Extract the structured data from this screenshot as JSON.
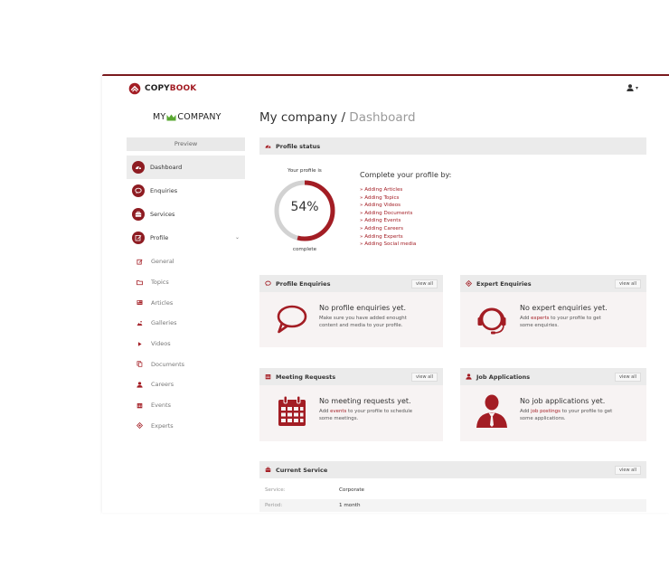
{
  "brand": {
    "name_dark": "COPY",
    "name_red": "BOOK",
    "accent": "#a31d24",
    "dark_accent": "#8e1c22"
  },
  "company": {
    "left": "MY",
    "right": "COMPANY"
  },
  "sidebar": {
    "preview_label": "Preview",
    "main_items": [
      {
        "label": "Dashboard",
        "icon": "dashboard-icon",
        "active": true
      },
      {
        "label": "Enquiries",
        "icon": "speech-bubble-icon"
      },
      {
        "label": "Services",
        "icon": "briefcase-icon"
      },
      {
        "label": "Profile",
        "icon": "edit-icon",
        "expandable": true
      }
    ],
    "sub_items": [
      {
        "label": "General",
        "icon": "edit-icon"
      },
      {
        "label": "Topics",
        "icon": "folder-icon"
      },
      {
        "label": "Articles",
        "icon": "newspaper-icon"
      },
      {
        "label": "Galleries",
        "icon": "image-icon"
      },
      {
        "label": "Videos",
        "icon": "play-icon"
      },
      {
        "label": "Documents",
        "icon": "documents-icon"
      },
      {
        "label": "Careers",
        "icon": "user-icon"
      },
      {
        "label": "Events",
        "icon": "calendar-icon"
      },
      {
        "label": "Experts",
        "icon": "target-icon"
      }
    ]
  },
  "header": {
    "title": "My company",
    "separator": " / ",
    "crumb": "Dashboard"
  },
  "profile_status": {
    "heading": "Profile status",
    "label_top": "Your profile is",
    "percent": 54,
    "percent_label": "54%",
    "label_bottom": "complete",
    "complete_heading": "Complete your profile by:",
    "items": [
      "» Adding Articles",
      "» Adding Topics",
      "» Adding Videos",
      "» Adding Documents",
      "» Adding Events",
      "» Adding Careers",
      "» Adding Experts",
      "» Adding Social media"
    ]
  },
  "cards": {
    "view_all": "view all",
    "profile_enquiries": {
      "heading": "Profile Enquiries",
      "title": "No profile enquiries yet.",
      "line1": "Make sure you have added enought",
      "line2": "content and media to your profile."
    },
    "expert_enquiries": {
      "heading": "Expert Enquiries",
      "title": "No expert enquiries yet.",
      "pre": "Add ",
      "link": "experts",
      "post": " to your profile to get",
      "line2": "some enquiries."
    },
    "meeting_requests": {
      "heading": "Meeting Requests",
      "title": "No meeting requests yet.",
      "pre": "Add ",
      "link": "events",
      "post": " to your profile to schedule",
      "line2": "some meetings."
    },
    "job_applications": {
      "heading": "Job Applications",
      "title": "No job applications yet.",
      "pre": "Add ",
      "link": "job postings",
      "post": " to your profile to get",
      "line2": "some applications."
    }
  },
  "current_service": {
    "heading": "Current Service",
    "rows": [
      {
        "key": "Service:",
        "value": "Corporate"
      },
      {
        "key": "Period:",
        "value": "1 month"
      }
    ]
  }
}
